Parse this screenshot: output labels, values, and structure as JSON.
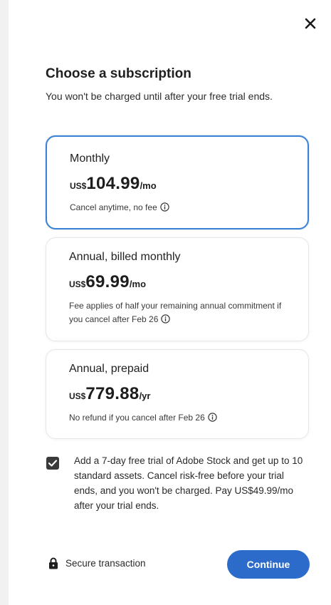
{
  "header": {
    "title": "Choose a subscription",
    "subtitle": "You won't be charged until after your free trial ends."
  },
  "plans": [
    {
      "name": "Monthly",
      "currency": "US$",
      "amount": "104.99",
      "period": "/mo",
      "note": "Cancel anytime, no fee",
      "selected": true
    },
    {
      "name": "Annual, billed monthly",
      "currency": "US$",
      "amount": "69.99",
      "period": "/mo",
      "note": "Fee applies of half your remaining annual commitment if you cancel after Feb 26",
      "selected": false
    },
    {
      "name": "Annual, prepaid",
      "currency": "US$",
      "amount": "779.88",
      "period": "/yr",
      "note": "No refund if you cancel after Feb 26",
      "selected": false
    }
  ],
  "addon": {
    "checked": true,
    "text": "Add a 7-day free trial of Adobe Stock and get up to 10 standard assets. Cancel risk-free before your trial ends, and you won't be charged. Pay US$49.99/mo after your trial ends."
  },
  "footer": {
    "secure_label": "Secure transaction",
    "continue_label": "Continue"
  },
  "icons": {
    "close": "close-icon",
    "info": "info-icon",
    "check": "checkmark-icon",
    "lock": "lock-icon"
  },
  "colors": {
    "accent": "#2c6bc9",
    "selected_border": "#3b82d4"
  }
}
